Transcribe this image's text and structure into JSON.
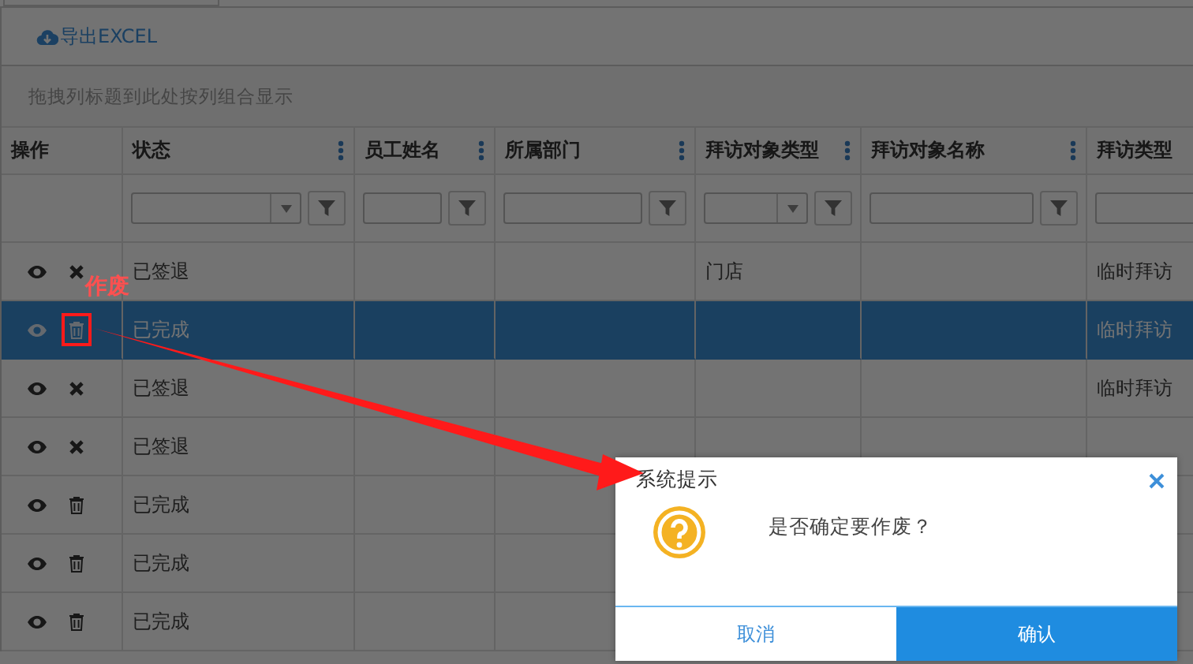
{
  "toolbar": {
    "export_label": "导出EXCEL"
  },
  "group_hint": "拖拽列标题到此处按列组合显示",
  "columns": [
    {
      "title": "操作",
      "menu": false
    },
    {
      "title": "状态",
      "menu": true,
      "filter": {
        "kind": "select"
      }
    },
    {
      "title": "员工姓名",
      "menu": true,
      "filter": {
        "kind": "text"
      }
    },
    {
      "title": "所属部门",
      "menu": true,
      "filter": {
        "kind": "text"
      }
    },
    {
      "title": "拜访对象类型",
      "menu": true,
      "filter": {
        "kind": "select"
      }
    },
    {
      "title": "拜访对象名称",
      "menu": true,
      "filter": {
        "kind": "text"
      }
    },
    {
      "title": "拜访类型",
      "filter": {
        "kind": "field"
      }
    }
  ],
  "rows": [
    {
      "kind": "delete",
      "status": "已签退",
      "visit_object_type": "门店",
      "visit_type": "临时拜访",
      "selected": false
    },
    {
      "kind": "void",
      "status": "已完成",
      "visit_type": "临时拜访",
      "selected": true
    },
    {
      "kind": "delete",
      "status": "已签退",
      "visit_type": "临时拜访",
      "selected": false
    },
    {
      "kind": "delete",
      "status": "已签退",
      "selected": false
    },
    {
      "kind": "void",
      "status": "已完成",
      "selected": false
    },
    {
      "kind": "void",
      "status": "已完成",
      "selected": false
    },
    {
      "kind": "void",
      "status": "已完成",
      "selected": false
    }
  ],
  "annotation": {
    "label": "作废"
  },
  "dialog": {
    "title": "系统提示",
    "message": "是否确定要作废？",
    "cancel": "取消",
    "confirm": "确认"
  }
}
